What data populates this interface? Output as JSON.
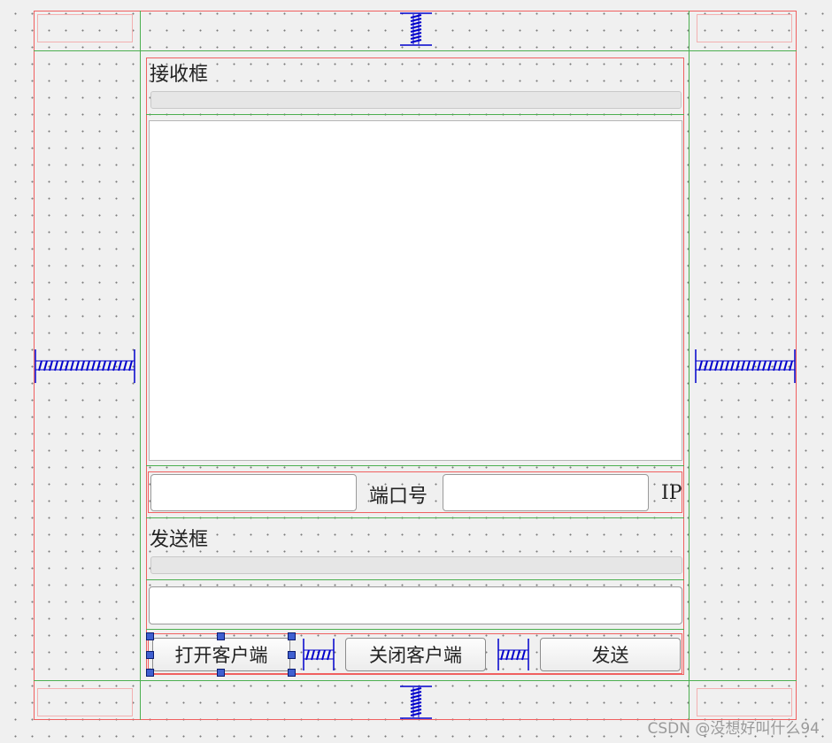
{
  "receive": {
    "title": "接收框"
  },
  "connection": {
    "port_label": "端口号",
    "ip_label": "IP"
  },
  "send": {
    "title": "发送框"
  },
  "buttons": {
    "open_client": "打开客户端",
    "close_client": "关闭客户端",
    "send": "发送"
  },
  "watermark": "CSDN @没想好叫什么94",
  "colors": {
    "layout_border": "#f06060",
    "layout_line": "#4caf50",
    "spacer": "#0000cc",
    "handle": "#3f5fd0"
  }
}
